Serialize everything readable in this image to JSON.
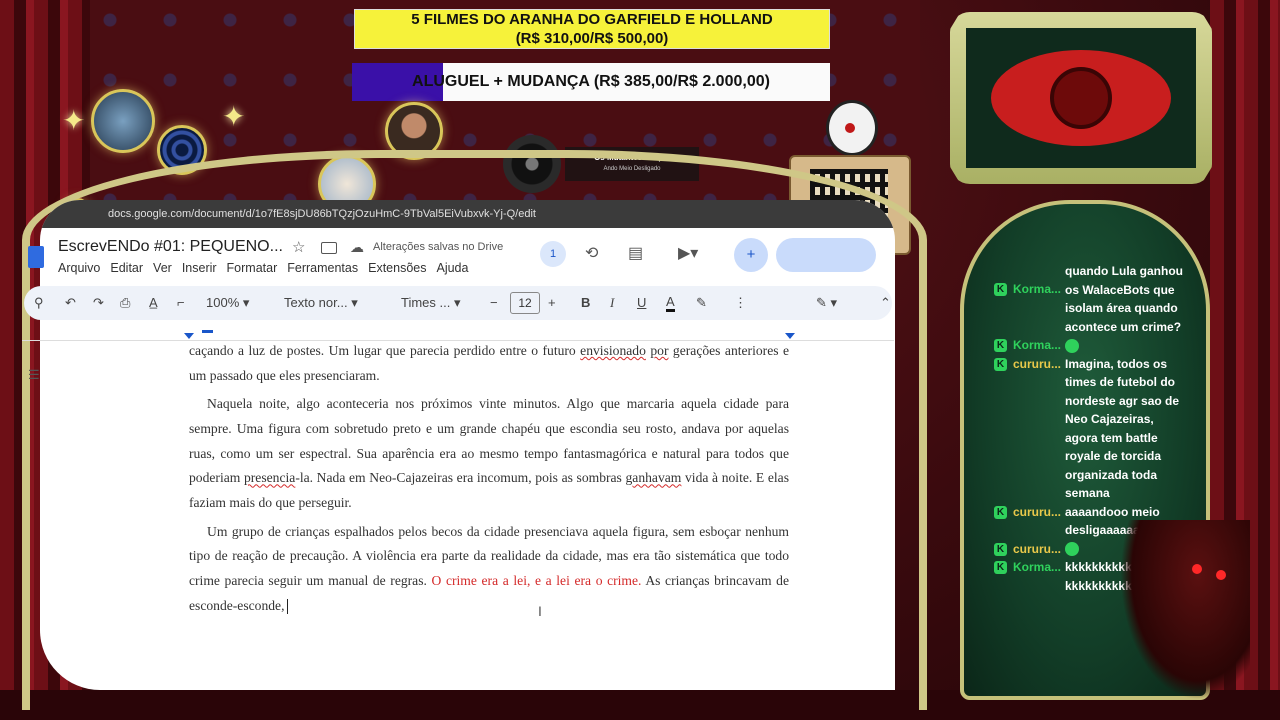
{
  "goals": {
    "goal1_line1": "5 FILMES DO ARANHA DO GARFIELD E HOLLAND",
    "goal1_line2": "(R$ 310,00/R$ 500,00)",
    "goal1_progress": 0.62,
    "goal2_label": "ALUGUEL + MUDANÇA (R$ 385,00/R$ 2.000,00)",
    "goal2_progress": 0.19
  },
  "music": {
    "track": "Os Mutantes - Topic",
    "album": "Ando Meio Desligado"
  },
  "browser": {
    "url": "docs.google.com/document/d/1o7fE8sjDU86bTQzjOzuHmC-9TbVal5EiVubxvk-Yj-Q/edit"
  },
  "docs": {
    "title": "EscrevENDo #01: PEQUENO...",
    "save_status": "Alterações salvas no Drive",
    "menu": [
      "Arquivo",
      "Editar",
      "Ver",
      "Inserir",
      "Formatar",
      "Ferramentas",
      "Extensões",
      "Ajuda"
    ],
    "users_count": "1",
    "toolbar": {
      "zoom": "100%",
      "style": "Texto nor...",
      "font": "Times ...",
      "font_size": "12",
      "minus": "−",
      "plus": "+",
      "bold": "B",
      "italic": "I",
      "underline": "U",
      "textcolor": "A"
    },
    "paragraphs": {
      "p1_a": "caçando a luz de postes. Um lugar que parecia perdido entre o futuro ",
      "p1_b": "envisionado",
      "p1_c": " ",
      "p1_d": "por",
      "p1_e": " gerações anteriores e um passado que eles presenciaram.",
      "p2_a": "Naquela noite, algo aconteceria nos próximos vinte minutos. Algo que marcaria aquela cidade para sempre. Uma figura com sobretudo preto e um grande chapéu que escondia seu rosto, andava por aquelas ruas, como um ser espectral. Sua aparência era ao mesmo tempo fantasmagórica e natural para todos que poderiam ",
      "p2_b": "presencia",
      "p2_c": "-la. Nada em Neo-Cajazeiras era incomum, pois as sombras ",
      "p2_d": "ganhavam",
      "p2_e": " vida à noite. E elas faziam mais do que perseguir.",
      "p3_a": "Um grupo de crianças espalhados pelos becos da cidade presenciava aquela figura, sem esboçar nenhum tipo de reação de precaução. A violência era parte da realidade da cidade, mas era tão sistemática que todo crime parecia seguir um manual de regras. ",
      "p3_red": "O crime era a lei, e a lei era o crime.",
      "p3_b": " As crianças brincavam de esconde-esconde,"
    }
  },
  "chat": [
    {
      "user": "",
      "text": "quando Lula ganhou os WalaceBots que isolam área quando acontece um crime?",
      "user_color": "#2fd15c",
      "continuation": true
    },
    {
      "user": "Korma...",
      "text": "",
      "user_color": "#2fd15c",
      "emote": true
    },
    {
      "user": "cururu...",
      "text": "Imagina, todos os times de futebol do nordeste agr sao de Neo Cajazeiras, agora tem battle royale de torcida organizada toda semana",
      "user_color": "#e8c84a"
    },
    {
      "user": "cururu...",
      "text": "aaaandooo meio desligaaaaaaadooo",
      "user_color": "#e8c84a"
    },
    {
      "user": "cururu...",
      "text": "",
      "user_color": "#e8c84a",
      "emote": true
    },
    {
      "user": "Korma...",
      "text": "kkkkkkkkkkkkkkkkkkkkkkkkkkkkk",
      "user_color": "#2fd15c"
    }
  ],
  "chat_header_user": "Korma..."
}
